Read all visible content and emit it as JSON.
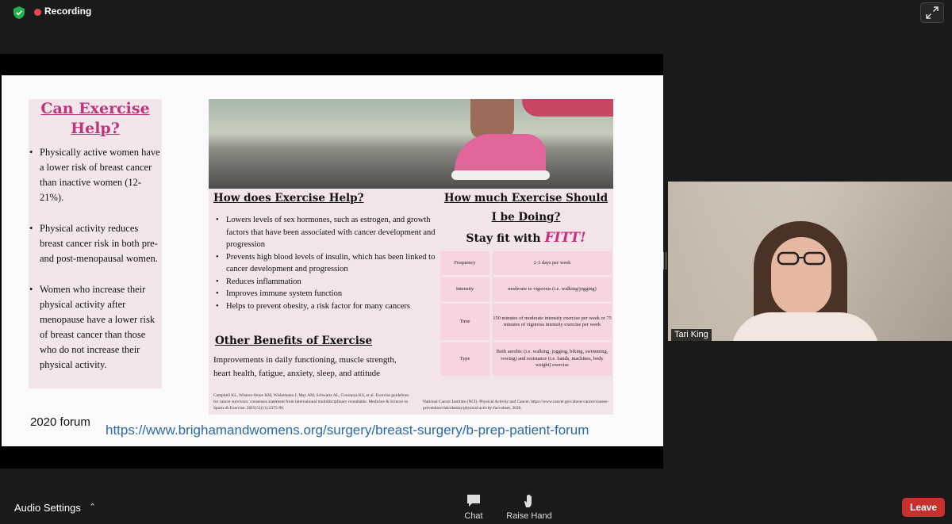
{
  "top_bar": {
    "recording_label": "Recording",
    "recording_color": "#e5484d",
    "security_icon": "shield-check-icon",
    "expand_icon": "fullscreen-icon"
  },
  "slide": {
    "left_panel": {
      "title": "Can Exercise Help?",
      "bullets": [
        "Physically active women have a lower risk of breast cancer than inactive women (12-21%).",
        "Physical activity reduces breast cancer risk in both pre- and post-menopausal women.",
        "Women who increase their physical activity after menopause have a lower risk of breast cancer than those who do not increase their physical activity."
      ]
    },
    "how_does": {
      "heading": "How does Exercise Help?",
      "bullets": [
        "Lowers levels of sex hormones, such as estrogen, and growth factors that have been associated with cancer development and progression",
        "Prevents high blood levels of insulin, which has been linked to cancer development and progression",
        "Reduces inflammation",
        "Improves immune system function",
        "Helps to prevent obesity, a risk factor for many cancers"
      ]
    },
    "other_benefits": {
      "heading": "Other Benefits of Exercise",
      "text": "Improvements in daily functioning, muscle strength, heart health, fatigue, anxiety, sleep, and attitude"
    },
    "reference_left": "Campbell KL, Winters-Stone KM, Wiskemann J, May AM, Schwartz AL, Courneya KS, et al. Exercise guidelines for cancer survivors: consensus statement from international multidisciplinary roundtable. Medicine & Science in Sports & Exercise. 2019;51(11):2375-90.",
    "how_much": {
      "heading_line1": "How much Exercise Should",
      "heading_line2": "I be Doing?",
      "stay_fit": "Stay fit with",
      "fitt": "FITT!"
    },
    "fitt_table": [
      {
        "label": "Frequency",
        "value": "2-3 days per week"
      },
      {
        "label": "Intensity",
        "value": "moderate to vigorous (i.e. walking/jogging)"
      },
      {
        "label": "Time",
        "value": "150 minutes of moderate intensity exercise per week or 75 minutes of vigorous intensity exercise per week"
      },
      {
        "label": "Type",
        "value": "Both aerobic (i.e. walking, jogging, biking, swimming, rowing) and resistance (i.e. bands, machines, body weight) exercise"
      }
    ],
    "reference_right": "National Cancer Institute (NCI). Physical Activity and Cancer. https://www.cancer.gov/about-cancer/causes-prevention/risk/obesity/physical-activity-fact-sheet, 2020.",
    "forum_label": "2020 forum",
    "link": "https://www.brighamandwomens.org/surgery/breast-surgery/b-prep-patient-forum",
    "title_color": "#c0347b",
    "link_color": "#2d6aa8"
  },
  "participant": {
    "name": "Tari King"
  },
  "toolbar": {
    "audio_settings": "Audio Settings",
    "chat": "Chat",
    "raise_hand": "Raise Hand",
    "leave": "Leave",
    "leave_color": "#c7302d"
  }
}
